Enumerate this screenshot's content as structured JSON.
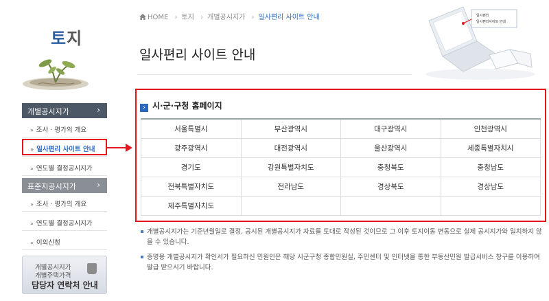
{
  "sidebar": {
    "section_title_1": "토",
    "section_title_2": "지",
    "menu1": {
      "label": "개별공시지가",
      "chevron": "›",
      "items": [
        {
          "label": "조사 · 평가의 개요"
        },
        {
          "label": "일사편리 사이트 안내"
        },
        {
          "label": "연도별 결정공시지가"
        }
      ]
    },
    "menu2": {
      "label": "표준지공시지가",
      "chevron": "›",
      "items": [
        {
          "label": "조사 · 평가의 개요"
        },
        {
          "label": "연도별 결정공시지가"
        },
        {
          "label": "이의신청"
        }
      ]
    },
    "contact": {
      "line1": "개별공시지가",
      "line2": "개별주택가격",
      "line3": "담당자 연락처 안내"
    }
  },
  "breadcrumb": {
    "home": "HOME",
    "items": [
      "토지",
      "개별공시지가",
      "일사편리 사이트 안내"
    ]
  },
  "page_title": "일사편리 사이트 안내",
  "hero": {
    "screen_text_1": "일사편리",
    "screen_text_2": "일사편리사이트 안내"
  },
  "section": {
    "title": "시·군·구청 홈페이지",
    "bullet": "›",
    "rows": [
      [
        "서울특별시",
        "부산광역시",
        "대구광역시",
        "인천광역시"
      ],
      [
        "광주광역시",
        "대전광역시",
        "울산광역시",
        "세종특별자치시"
      ],
      [
        "경기도",
        "강원특별자치도",
        "충청북도",
        "충청남도"
      ],
      [
        "전북특별자치도",
        "전라남도",
        "경상북도",
        "경상남도"
      ],
      [
        "제주특별자치도",
        "",
        "",
        ""
      ]
    ]
  },
  "notes": [
    "개별공시지가는 기준년월일로 결정, 공시된 개별공시지가 자료를 토대로 작성된 것이므로 그 이후 토지이동 변동으로 실제 공시지가와 일치하지 않을 수 있습니다.",
    "증명용 개별공시지가 확인서가 필요하신 민원인은 해당 시군구청 종합민원실, 주민센터 및 인터넷을 통한 부동산민원 발급서비스 창구를 이용하여 발급 받으시기 바랍니다."
  ],
  "colors": {
    "accent_blue": "#2a68c0",
    "highlight_red": "#e6141e",
    "menu_dark": "#4d5866",
    "menu_gray": "#8a8f96"
  }
}
